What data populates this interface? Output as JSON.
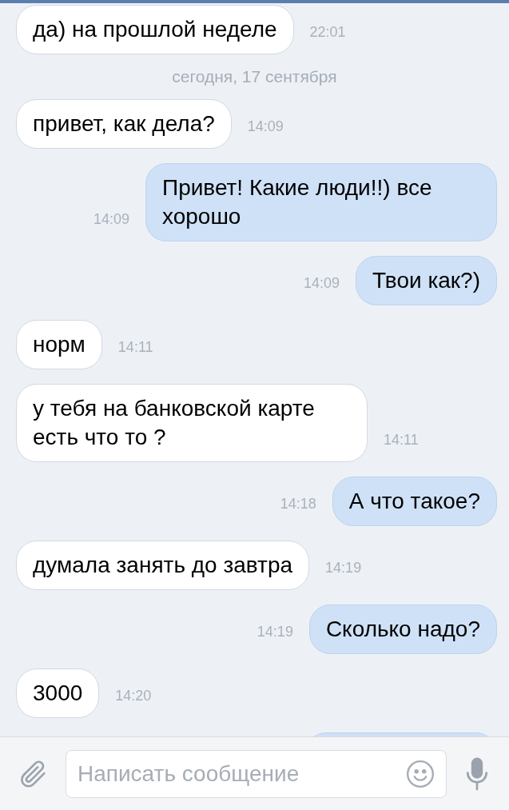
{
  "messages": [
    {
      "kind": "message",
      "outgoing": false,
      "text": "да) на прошлой неделе",
      "time": "22:01"
    },
    {
      "kind": "date",
      "text": "сегодня, 17 сентября"
    },
    {
      "kind": "message",
      "outgoing": false,
      "text": "привет, как дела?",
      "time": "14:09"
    },
    {
      "kind": "message",
      "outgoing": true,
      "text": "Привет! Какие люди!!) все хорошо",
      "time": "14:09"
    },
    {
      "kind": "message",
      "outgoing": true,
      "text": "Твои как?)",
      "time": "14:09"
    },
    {
      "kind": "message",
      "outgoing": false,
      "text": "норм",
      "time": "14:11"
    },
    {
      "kind": "message",
      "outgoing": false,
      "text": "у тебя на банковской карте есть что то ?",
      "time": "14:11"
    },
    {
      "kind": "message",
      "outgoing": true,
      "text": "А что такое?",
      "time": "14:18"
    },
    {
      "kind": "message",
      "outgoing": false,
      "text": "думала занять до завтра",
      "time": "14:19"
    },
    {
      "kind": "message",
      "outgoing": true,
      "text": "Сколько надо?",
      "time": "14:19"
    },
    {
      "kind": "message",
      "outgoing": false,
      "text": "3000",
      "time": "14:20"
    },
    {
      "kind": "clipped",
      "outgoing": true
    }
  ],
  "composer": {
    "placeholder": "Написать сообщение"
  }
}
